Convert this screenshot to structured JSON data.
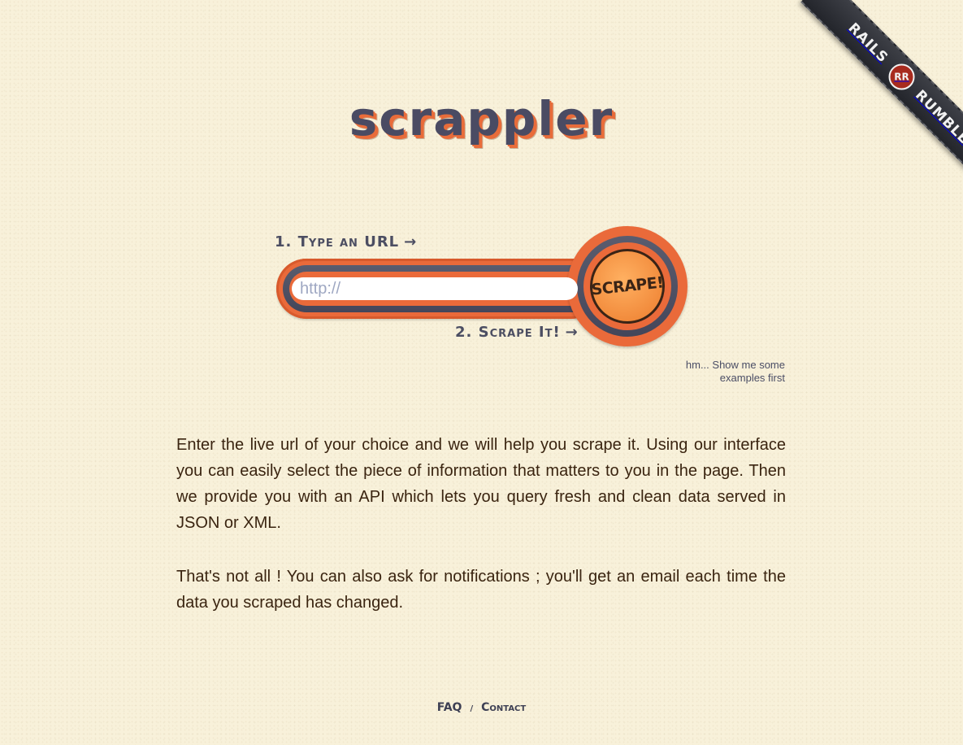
{
  "logo": {
    "text": "scrappler"
  },
  "ribbon": {
    "left_text": "RAILS",
    "badge_text": "RR",
    "right_text": "RUMBLE"
  },
  "steps": {
    "step1": "1. Type an URL",
    "step2": "2. Scrape It!",
    "arrow": "→"
  },
  "search": {
    "placeholder": "http://",
    "value": ""
  },
  "scrape_button": {
    "label": "SCRAPE!"
  },
  "examples_link": {
    "text": "hm... Show me some examples first"
  },
  "description": {
    "paragraph1": "Enter the live url of your choice and we will help you scrape it. Using our interface you can easily select the piece of information that matters to you in the page. Then we provide you with an API which lets you query fresh and clean data served in JSON or XML.",
    "paragraph2": "That's not all ! You can also ask for notifications ; you'll get an email each time the data you scraped has changed."
  },
  "footer": {
    "faq": "FAQ",
    "separator": "/",
    "contact": "Contact"
  },
  "colors": {
    "background": "#f8f1da",
    "accent_orange": "#ea6a3a",
    "slate": "#4a4b63",
    "text_brown": "#3a2410"
  }
}
